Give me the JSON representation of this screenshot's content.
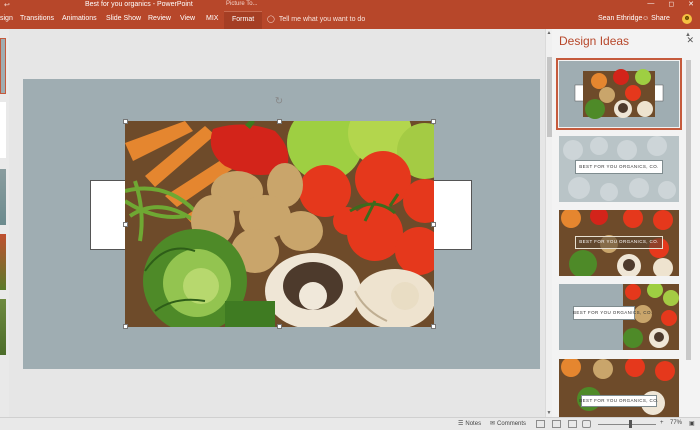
{
  "app": {
    "title": "Best for you organics - PowerPoint",
    "context_tab_label": "Picture To...",
    "user": "Sean Ethridge",
    "share_label": "Share",
    "qat_glyph": "↩",
    "window_controls": [
      "—",
      "◻",
      "✕"
    ]
  },
  "ribbon": {
    "tabs": [
      "sign",
      "Transitions",
      "Animations",
      "Slide Show",
      "Review",
      "View",
      "MIX",
      "Format"
    ],
    "active_tab": "Format",
    "tell_me": "Tell me what you want to do"
  },
  "design_ideas": {
    "title": "Design Ideas",
    "close_glyph": "✕",
    "ideas": [
      {
        "caption": "",
        "selected": true
      },
      {
        "caption": "BEST FOR YOU ORGANICS, CO.",
        "subtitle": "",
        "selected": false
      },
      {
        "caption": "BEST FOR YOU ORGANICS, CO.",
        "subtitle": "",
        "selected": false
      },
      {
        "caption": "BEST FOR YOU ORGANICS, CO.",
        "subtitle": "",
        "selected": false
      },
      {
        "caption": "BEST FOR YOU ORGANICS, CO.",
        "subtitle": "",
        "selected": false
      }
    ]
  },
  "statusbar": {
    "notes": "Notes",
    "comments": "Comments",
    "zoom": "77%"
  },
  "colors": {
    "accent": "#b7472a",
    "slide_bg": "#9fadb2",
    "selection": "#c55a3c"
  }
}
